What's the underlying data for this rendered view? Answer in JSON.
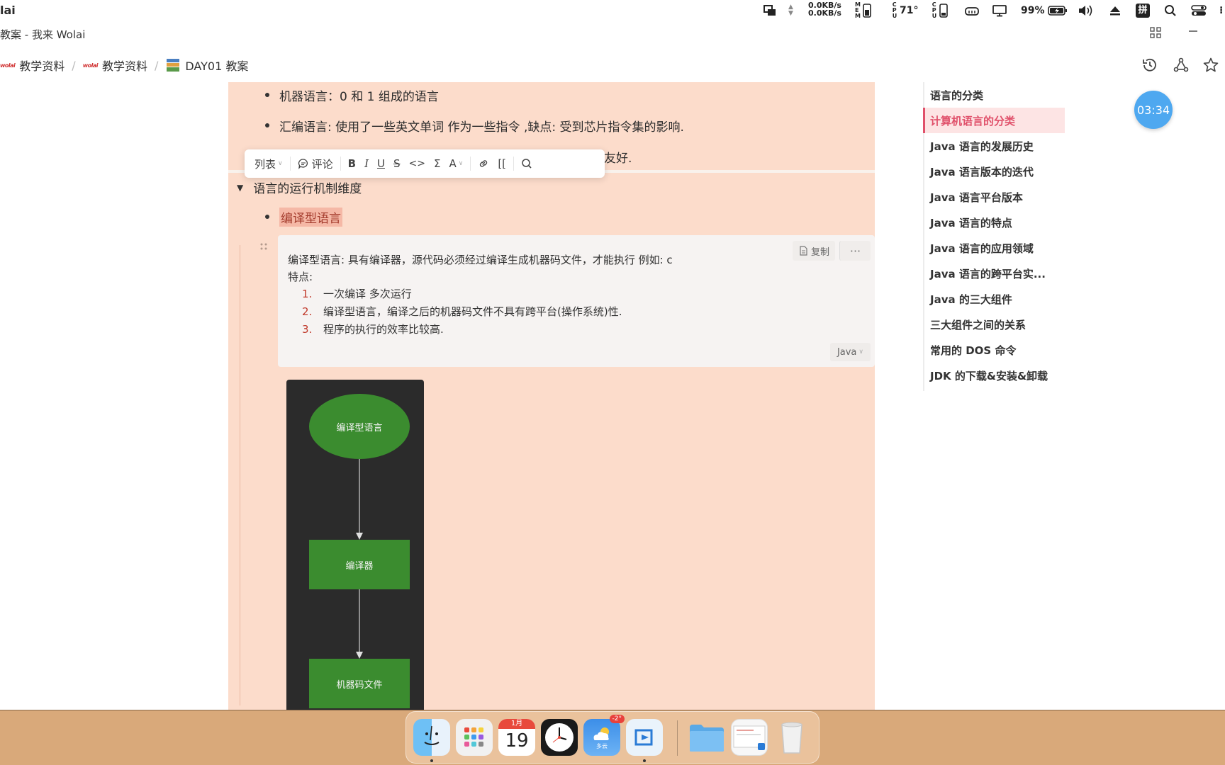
{
  "menubar": {
    "app_name": "lai",
    "net_up": "0.0KB/s",
    "net_down": "0.0KB/s",
    "mem_label": "MEM",
    "cpu_temp": "71°",
    "cpu_label": "CPU",
    "battery": "99%",
    "input_method": "拼"
  },
  "window": {
    "title": "教案 - 我来 Wolai"
  },
  "breadcrumb": {
    "items": [
      {
        "logo": "wolai",
        "label": "教学资料"
      },
      {
        "logo": "wolai",
        "label": "教学资料"
      },
      {
        "label": "DAY01 教案"
      }
    ],
    "separator": "/"
  },
  "document": {
    "bullets_top": [
      "机器语言：0  和 1 组成的语言",
      "汇编语言: 使用了一些英文单词 作为一些指令  ,缺点: 受到芯片指令集的影响.",
      "友好."
    ],
    "toggle_heading": "语言的运行机制维度",
    "compiled_label": "编译型语言",
    "code": {
      "line1": "编译型语言: 具有编译器，源代码必须经过编译生成机器码文件，才能执行   例如: c",
      "line2": "特点:",
      "items": [
        {
          "num": "1.",
          "text": "一次编译  多次运行"
        },
        {
          "num": "2.",
          "text": "编译型语言，编译之后的机器码文件不具有跨平台(操作系统)性."
        },
        {
          "num": "3.",
          "text": "程序的执行的效率比较高."
        }
      ],
      "copy_label": "复制",
      "more_label": "···",
      "language": "Java"
    },
    "diagram": {
      "nodes": [
        "编译型语言",
        "编译器",
        "机器码文件"
      ]
    }
  },
  "format_toolbar": {
    "list_label": "列表",
    "comment_label": "评论",
    "bold": "B",
    "italic": "I",
    "underline": "U",
    "strike": "S",
    "code": "<>",
    "formula": "Σ",
    "color": "A",
    "link_ref": "[["
  },
  "outline": {
    "items": [
      "语言的分类",
      "计算机语言的分类",
      "Java 语言的发展历史",
      "Java 语言版本的迭代",
      "Java 语言平台版本",
      "Java 语言的特点",
      "Java 语言的应用领域",
      "Java 语言的跨平台实...",
      "Java 的三大组件",
      "三大组件之间的关系",
      "常用的 DOS 命令",
      "JDK 的下载&安装&卸载"
    ],
    "active_index": 1
  },
  "timer": "03:34",
  "dock": {
    "calendar_month": "1月",
    "calendar_day": "19",
    "weather_badge": "-2°",
    "weather_label": "多云"
  },
  "colors": {
    "accent": "#e0506a",
    "doc_bg": "#fcdccb",
    "timer": "#4ea8f0",
    "diagram_green": "#3b8c2f"
  }
}
